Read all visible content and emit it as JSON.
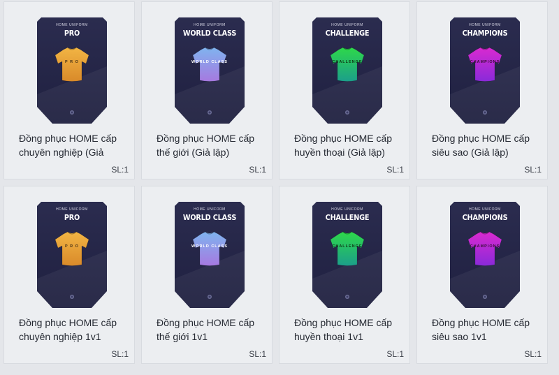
{
  "items": [
    {
      "uniform_label": "HOME UNIFORM",
      "tier": "PRO",
      "jersey_text": "P R O",
      "title": "Đồng phục HOME cấp chuyên nghiệp (Giả",
      "qty": "SL:1",
      "jersey_top": "#f2b544",
      "jersey_bottom": "#d98a2a",
      "jersey_text_color": "#4a3418"
    },
    {
      "uniform_label": "HOME UNIFORM",
      "tier": "WORLD CLASS",
      "jersey_text": "WORLD CLASS",
      "title": "Đồng phục HOME cấp thế giới (Giả lập)",
      "qty": "SL:1",
      "jersey_top": "#7fb4ef",
      "jersey_bottom": "#a679e0",
      "jersey_text_color": "#ffffff"
    },
    {
      "uniform_label": "HOME UNIFORM",
      "tier": "CHALLENGE",
      "jersey_text": "CHALLENGE",
      "title": "Đồng phục HOME cấp huyền thoại (Giả lập)",
      "qty": "SL:1",
      "jersey_top": "#2ed84a",
      "jersey_bottom": "#1c9f8a",
      "jersey_text_color": "#0f3a16"
    },
    {
      "uniform_label": "HOME UNIFORM",
      "tier": "CHAMPIONS",
      "jersey_text": "CHAMPIONS",
      "title": "Đồng phục HOME cấp siêu sao (Giả lập)",
      "qty": "SL:1",
      "jersey_top": "#d92ad0",
      "jersey_bottom": "#8a2ad9",
      "jersey_text_color": "#3a0e3a"
    },
    {
      "uniform_label": "HOME UNIFORM",
      "tier": "PRO",
      "jersey_text": "P R O",
      "title": "Đồng phục HOME cấp chuyên nghiệp 1v1",
      "qty": "SL:1",
      "jersey_top": "#f2b544",
      "jersey_bottom": "#d98a2a",
      "jersey_text_color": "#4a3418"
    },
    {
      "uniform_label": "HOME UNIFORM",
      "tier": "WORLD CLASS",
      "jersey_text": "WORLD CLASS",
      "title": "Đồng phục HOME cấp thế giới 1v1",
      "qty": "SL:1",
      "jersey_top": "#7fb4ef",
      "jersey_bottom": "#a679e0",
      "jersey_text_color": "#ffffff"
    },
    {
      "uniform_label": "HOME UNIFORM",
      "tier": "CHALLENGE",
      "jersey_text": "CHALLENGE",
      "title": "Đồng phục HOME cấp huyền thoại 1v1",
      "qty": "SL:1",
      "jersey_top": "#2ed84a",
      "jersey_bottom": "#1c9f8a",
      "jersey_text_color": "#0f3a16"
    },
    {
      "uniform_label": "HOME UNIFORM",
      "tier": "CHAMPIONS",
      "jersey_text": "CHAMPIONS",
      "title": "Đồng phục HOME cấp siêu sao 1v1",
      "qty": "SL:1",
      "jersey_top": "#d92ad0",
      "jersey_bottom": "#8a2ad9",
      "jersey_text_color": "#3a0e3a"
    }
  ],
  "colors": {
    "card_bg": "#2b2c4f",
    "card_bg_dark": "#1f2040",
    "page_bg": "#e4e6ea"
  }
}
